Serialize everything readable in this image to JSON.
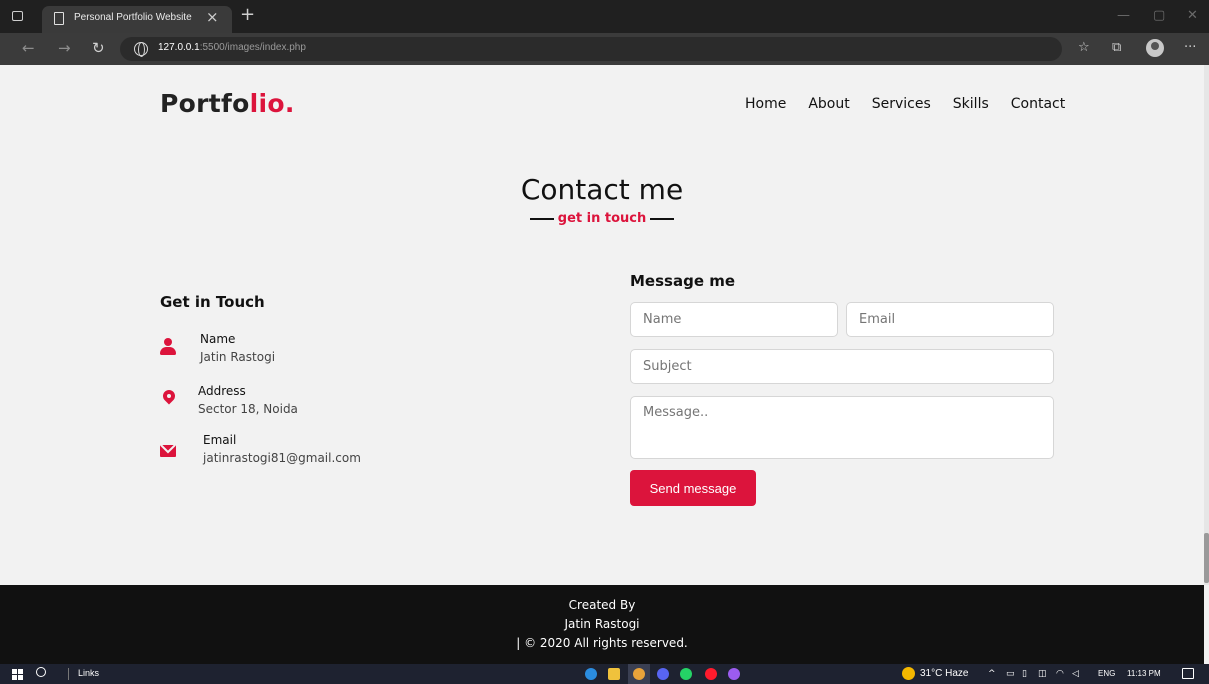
{
  "browser": {
    "tab_title": "Personal Portfolio Website",
    "tab_close": "×",
    "new_tab": "+",
    "url_host": "127.0.0.1",
    "url_rest": ":5500/images/index.php"
  },
  "site": {
    "logo_main": "Portfo",
    "logo_accent": "lio.",
    "nav": [
      "Home",
      "About",
      "Services",
      "Skills",
      "Contact"
    ]
  },
  "contact": {
    "title": "Contact me",
    "subtitle": "get in touch",
    "get_in_touch": "Get in Touch",
    "info": [
      {
        "head": "Name",
        "value": "Jatin Rastogi",
        "icon": "person-icon"
      },
      {
        "head": "Address",
        "value": "Sector 18, Noida",
        "icon": "map-marker-icon"
      },
      {
        "head": "Email",
        "value": "jatinrastogi81@gmail.com",
        "icon": "envelope-icon"
      }
    ],
    "message_title": "Message me",
    "form": {
      "name_placeholder": "Name",
      "email_placeholder": "Email",
      "subject_placeholder": "Subject",
      "message_placeholder": "Message..",
      "send_label": "Send message"
    }
  },
  "footer": {
    "line1": "Created By",
    "line2": "Jatin Rastogi",
    "line3": "| © 2020 All rights reserved."
  },
  "taskbar": {
    "links": "Links",
    "weather": "31°C  Haze",
    "lang": "ENG",
    "time": "11:13 PM"
  },
  "colors": {
    "accent": "#dc143c",
    "footer_bg": "#111111",
    "page_bg": "#f2f2f2"
  }
}
